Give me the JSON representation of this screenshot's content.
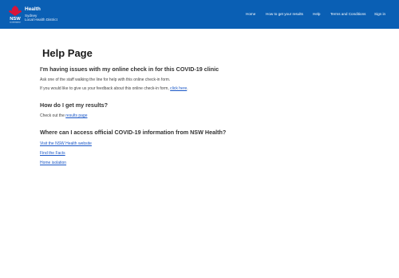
{
  "brand": {
    "name": "Health",
    "sub_line1": "Sydney",
    "sub_line2": "Local Health District",
    "logo_text": "NSW",
    "logo_caption": "GOVERNMENT"
  },
  "nav": {
    "home": "Home",
    "results": "How to get your results",
    "help": "Help",
    "terms": "Terms and Conditions",
    "signin": "Sign in"
  },
  "page": {
    "title": "Help Page",
    "section1": {
      "heading": "I'm having issues with my online check in for this COVID-19 clinic",
      "p1": "Ask one of the staff walking the line for help with this online check-in form.",
      "p2_prefix": "If you would like to give us your feedback about this online check-in form, ",
      "p2_link": "click here",
      "p2_suffix": "."
    },
    "section2": {
      "heading": "How do I get my results?",
      "p_prefix": "Check out the ",
      "p_link": "results page"
    },
    "section3": {
      "heading": "Where can I access official COVID-19 information from NSW Health?",
      "links": [
        "Visit the NSW Health website",
        "Find the Facts",
        "Home isolation"
      ]
    }
  },
  "colors": {
    "header_bg": "#0a5fb4",
    "link": "#1a57c7",
    "logo_red": "#d7153a"
  }
}
